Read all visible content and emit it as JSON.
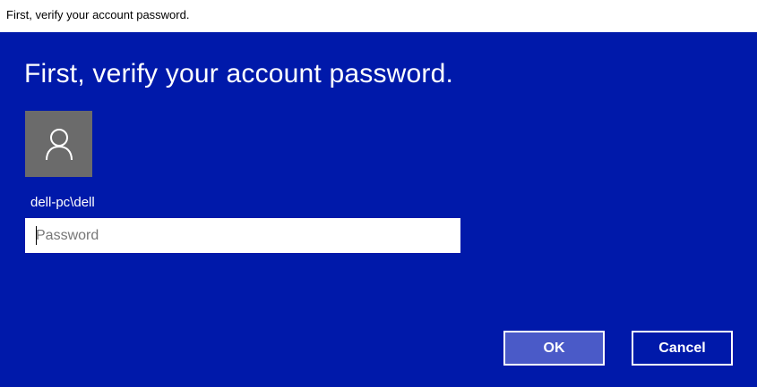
{
  "window": {
    "title": "First, verify your account password."
  },
  "dialog": {
    "heading": "First, verify your account password.",
    "avatar_icon": "user-icon",
    "account_name": "dell-pc\\dell",
    "password_placeholder": "Password",
    "password_value": "",
    "ok_label": "OK",
    "cancel_label": "Cancel"
  },
  "colors": {
    "background": "#0019aa",
    "ok_button": "#4a5ac8",
    "avatar_tile": "#6b6b6b",
    "text": "#ffffff"
  }
}
